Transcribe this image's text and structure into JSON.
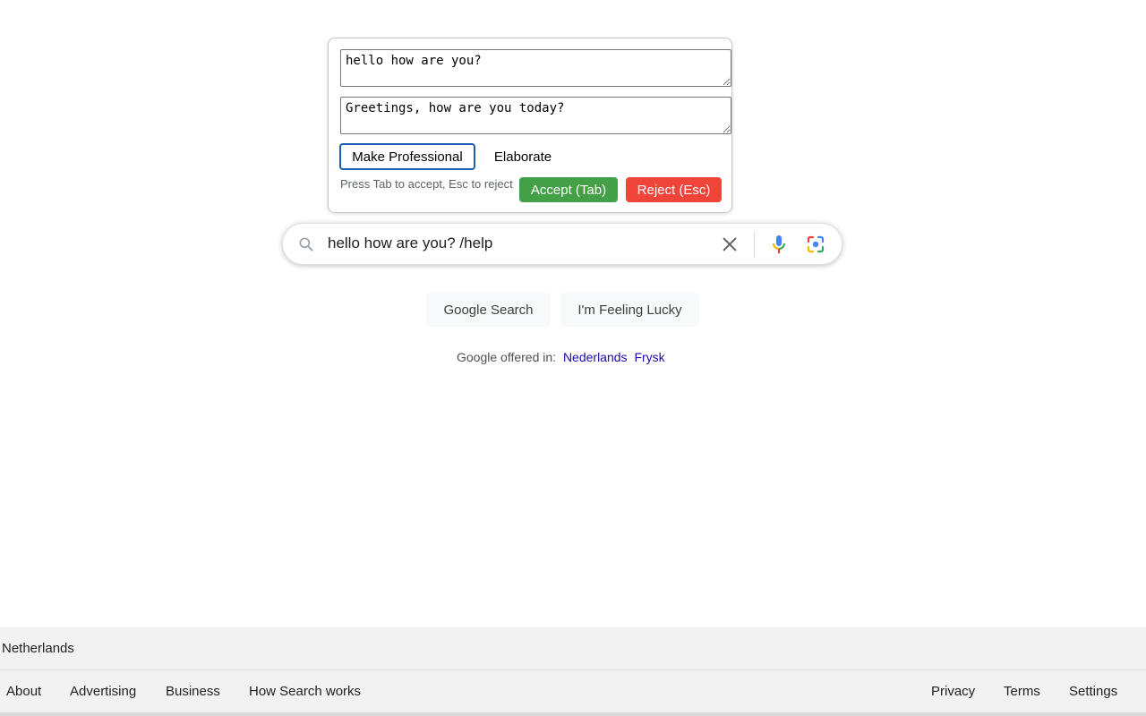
{
  "popup": {
    "original_text": "hello how are you?",
    "suggested_text": "Greetings, how are you today?",
    "options": [
      {
        "label": "Make Professional"
      },
      {
        "label": "Elaborate"
      }
    ],
    "hint": "Press Tab to accept, Esc to reject",
    "accept_label": "Accept (Tab)",
    "reject_label": "Reject (Esc)"
  },
  "search": {
    "value": "hello how are you? /help",
    "icons": [
      "search-icon",
      "clear-icon",
      "mic-icon",
      "lens-icon"
    ]
  },
  "buttons": {
    "search_label": "Google Search",
    "lucky_label": "I'm Feeling Lucky"
  },
  "offered": {
    "prefix": "Google offered in:",
    "languages": [
      "Nederlands",
      "Frysk"
    ]
  },
  "footer": {
    "country": "Netherlands",
    "left_links": [
      "About",
      "Advertising",
      "Business",
      "How Search works"
    ],
    "right_links": [
      "Privacy",
      "Terms",
      "Settings"
    ]
  },
  "colors": {
    "accept": "#43a047",
    "reject": "#f0433a",
    "link": "#1a0dab",
    "focus_border": "#1a5fb4"
  }
}
